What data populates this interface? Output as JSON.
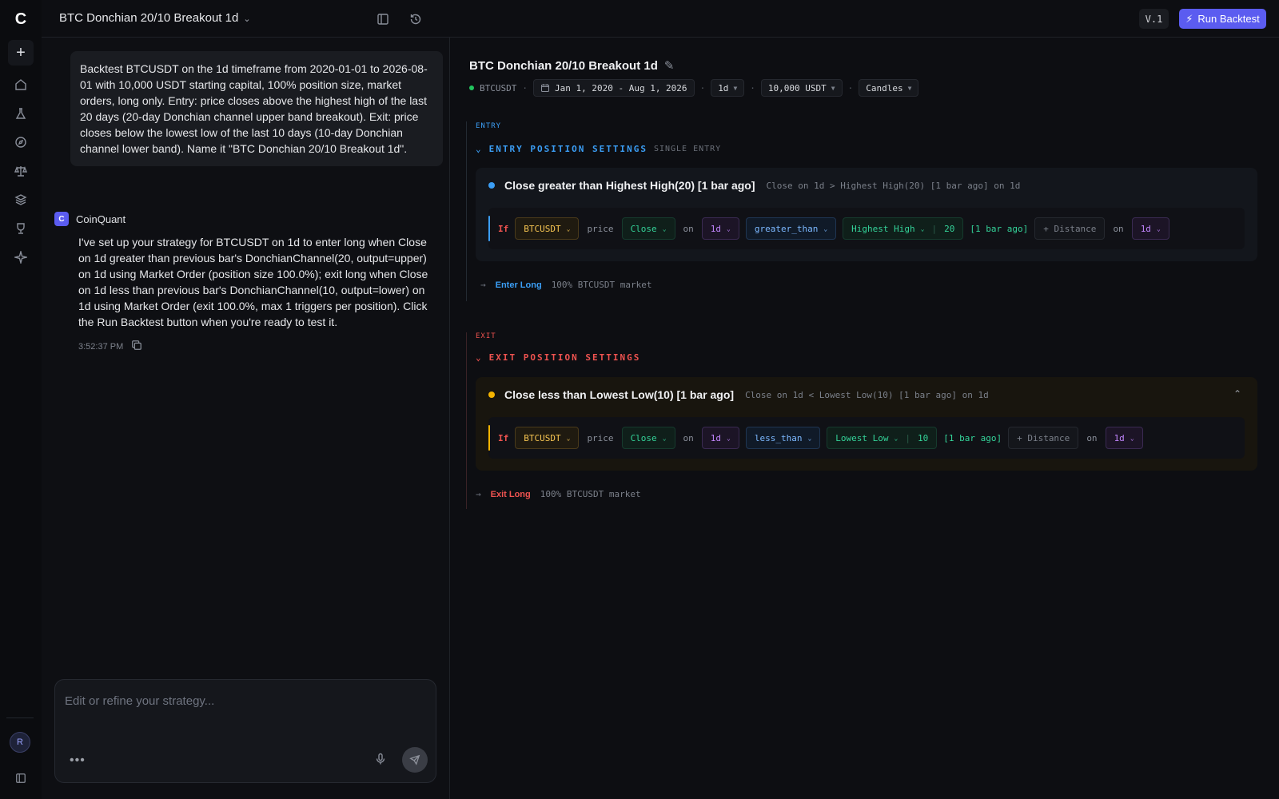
{
  "app": {
    "strategy_name": "BTC Donchian 20/10 Breakout 1d",
    "version": "V.1",
    "run_label": "Run Backtest"
  },
  "rail": {
    "logo": "C",
    "avatar_initial": "R",
    "icons": [
      "plus-icon",
      "home-icon",
      "flask-icon",
      "compass-icon",
      "scales-icon",
      "layers-icon",
      "trophy-icon",
      "sparkle-icon",
      "sidebar-toggle-icon"
    ]
  },
  "chat": {
    "user_message": "Backtest BTCUSDT on the 1d timeframe from 2020-01-01 to 2026-08-01 with 10,000 USDT starting capital, 100% position size, market orders, long only. Entry: price closes above the highest high of the last 20 days (20-day Donchian channel upper band breakout). Exit: price closes below the lowest low of the last 10 days (10-day Donchian channel lower band). Name it \"BTC Donchian 20/10 Breakout 1d\".",
    "assistant_name": "CoinQuant",
    "assistant_message": "I've set up your strategy for BTCUSDT on 1d to enter long when Close on 1d greater than previous bar's DonchianChannel(20, output=upper) on 1d using Market Order (position size 100.0%); exit long when Close on 1d less than previous bar's DonchianChannel(10, output=lower) on 1d using Market Order (exit 100.0%, max 1 triggers per position). Click the Run Backtest button when you're ready to test it.",
    "timestamp": "3:52:37 PM",
    "composer_placeholder": "Edit or refine your strategy..."
  },
  "strategy": {
    "title": "BTC Donchian 20/10 Breakout 1d",
    "symbol": "BTCUSDT",
    "date_range": "Jan 1, 2020 - Aug 1, 2026",
    "timeframe": "1d",
    "capital": "10,000 USDT",
    "chart_type": "Candles"
  },
  "entry": {
    "tag": "ENTRY",
    "heading": "ENTRY POSITION SETTINGS",
    "subheading": "SINGLE ENTRY",
    "condition_name": "Close greater than Highest High(20) [1 bar ago]",
    "condition_desc": "Close on 1d > Highest High(20) [1 bar ago] on 1d",
    "if_label": "If",
    "symbol": "BTCUSDT",
    "price_label": "price",
    "source": "Close",
    "on_label": "on",
    "tf1": "1d",
    "operator": "greater_than",
    "indicator": "Highest High",
    "period": "20",
    "offset": "[1 bar ago]",
    "distance": "+ Distance",
    "tf2": "1d",
    "action_label": "Enter Long",
    "action_detail": "100% BTCUSDT market",
    "color": "#3b9ef5"
  },
  "exit": {
    "tag": "EXIT",
    "heading": "EXIT POSITION SETTINGS",
    "condition_name": "Close less than Lowest Low(10) [1 bar ago]",
    "condition_desc": "Close on 1d < Lowest Low(10) [1 bar ago] on 1d",
    "if_label": "If",
    "symbol": "BTCUSDT",
    "price_label": "price",
    "source": "Close",
    "on_label": "on",
    "tf1": "1d",
    "operator": "less_than",
    "indicator": "Lowest Low",
    "period": "10",
    "offset": "[1 bar ago]",
    "distance": "+ Distance",
    "tf2": "1d",
    "action_label": "Exit Long",
    "action_detail": "100% BTCUSDT market",
    "color": "#ef5350"
  }
}
